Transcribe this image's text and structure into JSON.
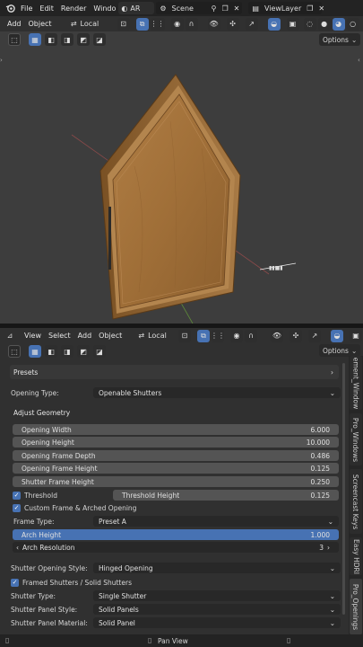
{
  "topbar": {
    "menus": [
      "File",
      "Edit",
      "Render",
      "Windo"
    ],
    "workspace": "AR",
    "scene": "Scene",
    "view_layer": "ViewLayer"
  },
  "header1": {
    "add": "Add",
    "object": "Object",
    "orientation": "Local",
    "options": "Options"
  },
  "header2": {
    "view": "View",
    "select": "Select",
    "add": "Add",
    "object": "Object",
    "orientation": "Local",
    "options": "Options"
  },
  "panel": {
    "presets": "Presets",
    "opening_type_label": "Opening Type:",
    "opening_type_value": "Openable Shutters",
    "adjust_geometry": "Adjust Geometry",
    "fields": [
      {
        "label": "Opening Width",
        "value": "6.000"
      },
      {
        "label": "Opening Height",
        "value": "10.000"
      },
      {
        "label": "Opening Frame Depth",
        "value": "0.486"
      },
      {
        "label": "Opening Frame Height",
        "value": "0.125"
      },
      {
        "label": "Shutter Frame Height",
        "value": "0.250"
      }
    ],
    "threshold_label": "Threshold",
    "threshold_height_label": "Threshold Height",
    "threshold_height_value": "0.125",
    "custom_frame_label": "Custom Frame & Arched Opening",
    "frame_type_label": "Frame Type:",
    "frame_type_value": "Preset A",
    "arch_height_label": "Arch Height",
    "arch_height_value": "1.000",
    "arch_resolution_label": "Arch Resolution",
    "arch_resolution_value": "3",
    "shutter_opening_style_label": "Shutter Opening Style:",
    "shutter_opening_style_value": "Hinged Opening",
    "framed_shutters_label": "Framed Shutters / Solid Shutters",
    "shutter_type_label": "Shutter Type:",
    "shutter_type_value": "Single Shutter",
    "shutter_panel_style_label": "Shutter Panel Style:",
    "shutter_panel_style_value": "Solid Panels",
    "shutter_panel_material_label": "Shutter Panel Material:",
    "shutter_panel_material_value": "Solid Panel"
  },
  "tabs": [
    "ement_Window",
    "Pro_Windows",
    "Screencast Keys",
    "Easy HDRI",
    "Pro_Openings"
  ],
  "status": {
    "pan_view": "Pan View"
  },
  "colors": {
    "accent": "#4772b3",
    "viewport": "#3d3d3d",
    "panel": "#303030",
    "wood": "#a8773d"
  },
  "icons": [
    "blender-logo-icon",
    "pin-icon",
    "new-scene-icon",
    "close-icon",
    "overlay-icon",
    "xray-icon",
    "wireframe-shading-icon",
    "solid-shading-icon",
    "material-shading-icon",
    "rendered-shading-icon",
    "select-box-icon",
    "gizmo-icon",
    "mouse-icon"
  ]
}
